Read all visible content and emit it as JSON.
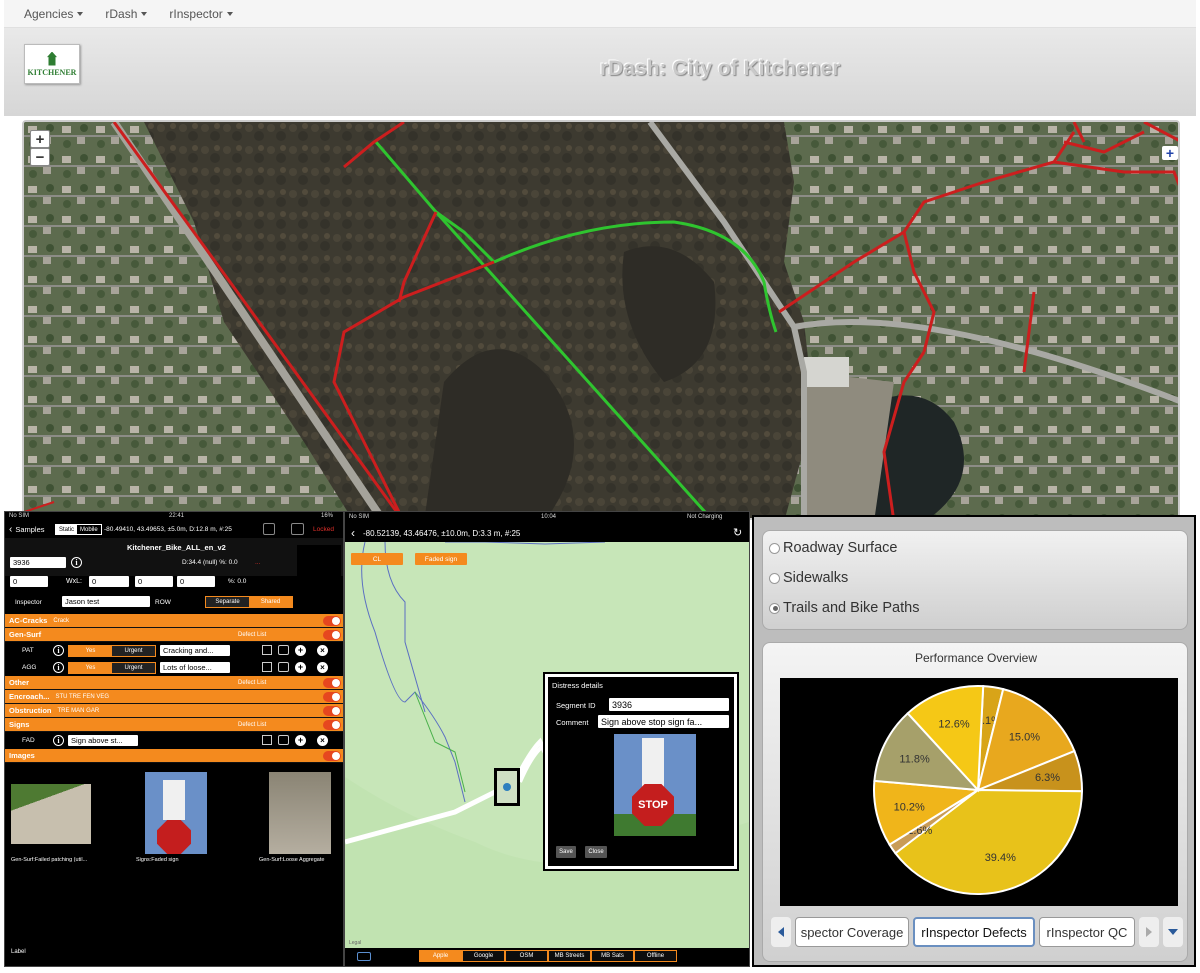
{
  "nav": {
    "items": [
      "Agencies",
      "rDash",
      "rInspector"
    ]
  },
  "header": {
    "logo_text": "KITCHENER",
    "title": "rDash: City of Kitchener"
  },
  "map": {
    "zoom_in": "+",
    "zoom_out": "−",
    "layers": "+"
  },
  "phone1": {
    "status": {
      "carrier": "No SIM",
      "time": "22:41",
      "battery": "16%"
    },
    "back_label": "Samples",
    "seg_static": "Static",
    "seg_mobile": "Mobile",
    "coords": "-80.49410, 43.49653, ±5.0m, D:12.8 m, #:25",
    "locked": "Locked",
    "layer_name": "Kitchener_Bike_ALL_en_v2",
    "segment_id": "3936",
    "d_line": "D:34.4 (null)  %: 0.0",
    "d_flag": "...",
    "zero_a": "0",
    "wxl_label": "WxL:",
    "wxl_vals": [
      "0",
      "0",
      "0"
    ],
    "pct_line": "%: 0.0",
    "inspector_label": "Inspector",
    "inspector_value": "Jason test",
    "row_label": "ROW",
    "separate": "Separate",
    "shared": "Shared",
    "sections": [
      {
        "title": "AC-Cracks",
        "sub": "Crack",
        "defect": ""
      },
      {
        "title": "Gen-Surf",
        "sub": "",
        "defect": "Defect List"
      }
    ],
    "defects": [
      {
        "code": "PAT",
        "yes": "Yes",
        "urgent": "Urgent",
        "value": "Cracking and..."
      },
      {
        "code": "AGG",
        "yes": "Yes",
        "urgent": "Urgent",
        "value": "Lots of loose..."
      }
    ],
    "sections2": [
      {
        "title": "Other",
        "sub": "",
        "defect": "Defect List"
      },
      {
        "title": "Encroach...",
        "sub": "STU    TRE    FEN    VEG",
        "defect": ""
      },
      {
        "title": "Obstruction",
        "sub": "TRE    MAN    GAR",
        "defect": ""
      },
      {
        "title": "Signs",
        "sub": "",
        "defect": "Defect List"
      }
    ],
    "sign_defect": {
      "code": "FAD",
      "value": "Sign above st..."
    },
    "images_title": "Images",
    "image_captions": [
      "Gen-Surf:Failed patching (util...",
      "Signs:Faded sign",
      "Gen-Surf:Loose Aggregate"
    ],
    "label": "Label"
  },
  "phone2": {
    "status": {
      "carrier": "No SIM",
      "time": "10:04",
      "charge": "Not Charging"
    },
    "coords": "-80.52139, 43.46476, ±10.0m, D:3.3 m, #:25",
    "btn_cl": "CL",
    "btn_faded": "Faded sign",
    "popup": {
      "title": "Distress details",
      "segment_label": "Segment ID",
      "segment_value": "3936",
      "comment_label": "Comment",
      "comment_value": "Sign above stop sign fa...",
      "save": "Save",
      "close": "Close"
    },
    "map_tabs": [
      "Apple",
      "Google",
      "OSM",
      "MB Streets",
      "MB Sats",
      "Offline"
    ],
    "legal": "Legal"
  },
  "right": {
    "radios": [
      {
        "label": "Roadway Surface",
        "selected": false
      },
      {
        "label": "Sidewalks",
        "selected": false
      },
      {
        "label": "Trails and Bike Paths",
        "selected": true
      }
    ],
    "perf_title": "Performance Overview",
    "tabs": [
      "spector Coverage",
      "rInspector Defects",
      "rInspector QC"
    ]
  },
  "chart_data": {
    "type": "pie",
    "title": "Performance Overview",
    "values": [
      3.1,
      15.0,
      6.3,
      39.4,
      1.6,
      10.2,
      11.8,
      12.6
    ],
    "labels": [
      "3.1%",
      "15.0%",
      "6.3%",
      "39.4%",
      "1.6%",
      "10.2%",
      "11.8%",
      "12.6%"
    ],
    "colors": [
      "#d8a418",
      "#e8a81e",
      "#c8921c",
      "#e8c21a",
      "#c99c57",
      "#f0b51a",
      "#a6a06a",
      "#f5c816"
    ]
  }
}
